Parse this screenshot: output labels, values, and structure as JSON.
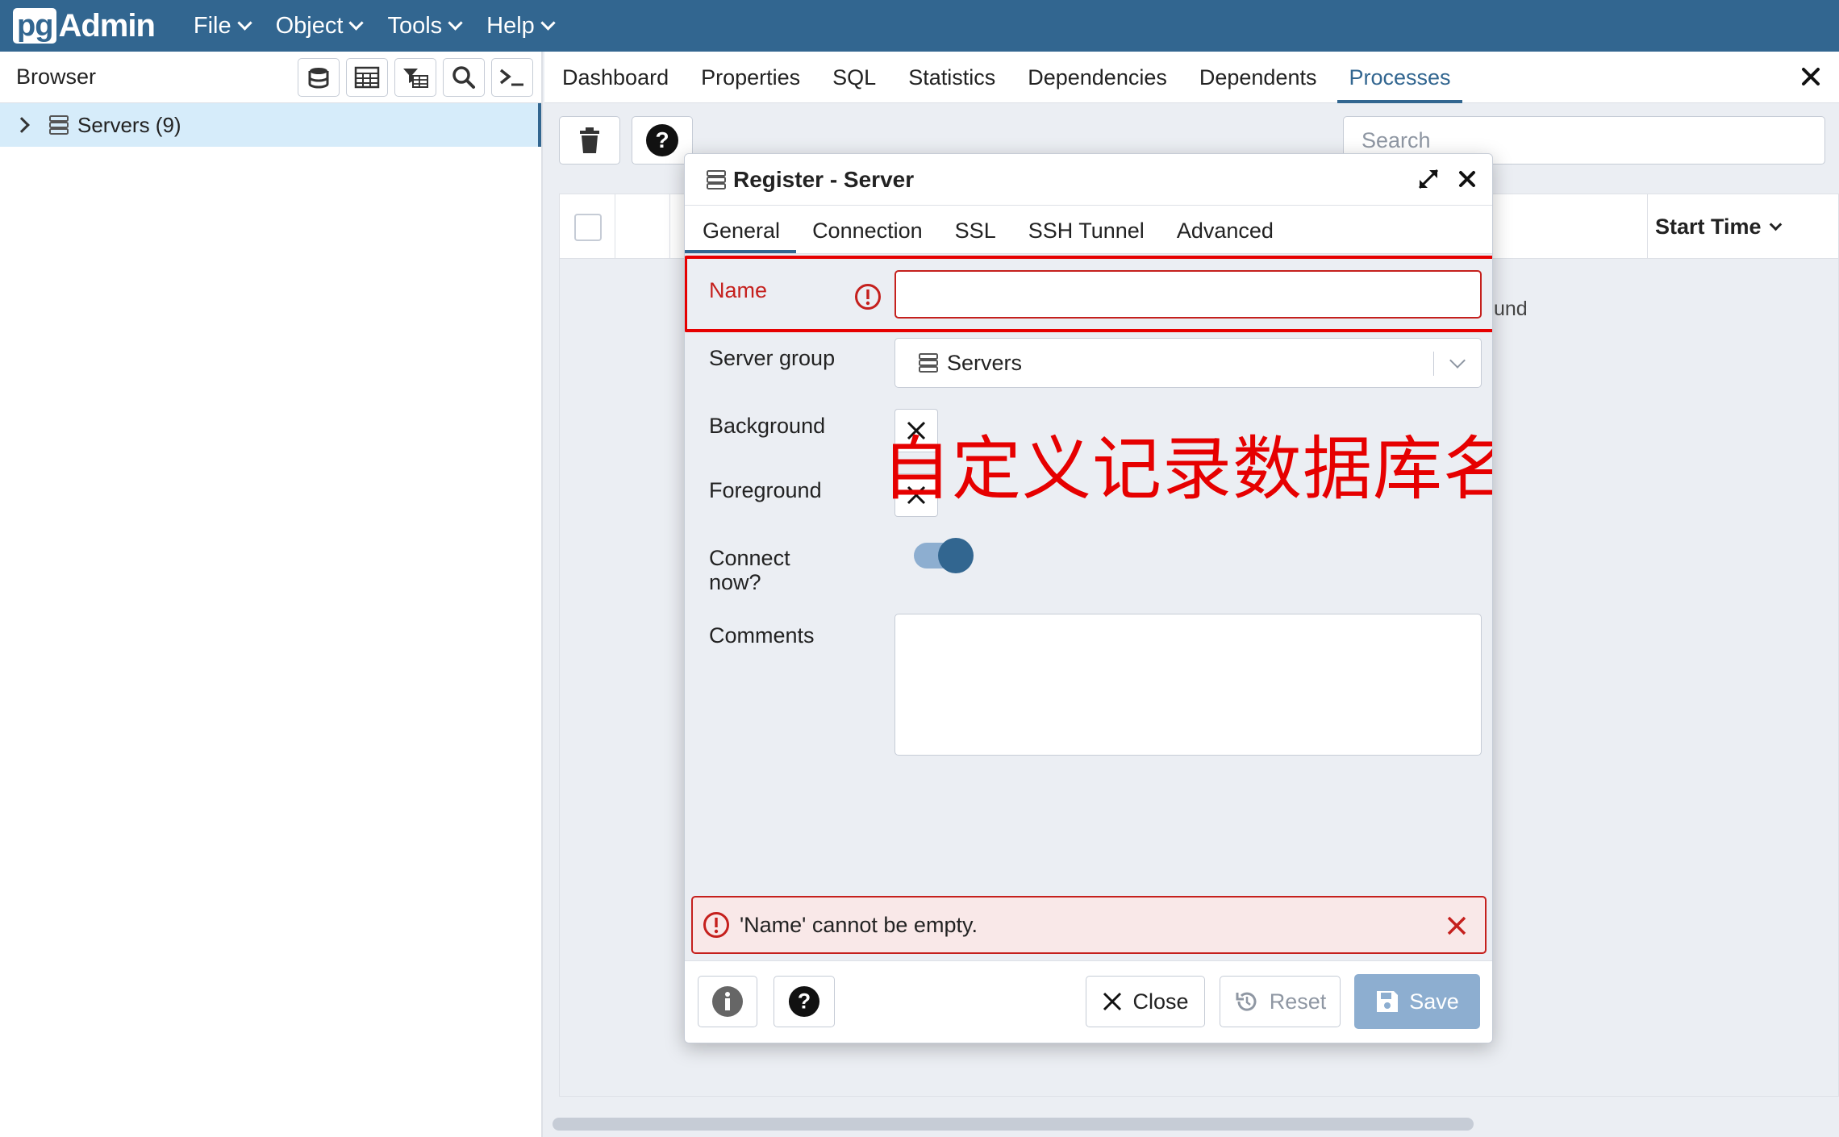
{
  "app": {
    "logo_prefix": "pg",
    "logo_text": "Admin"
  },
  "menu": [
    {
      "label": "File"
    },
    {
      "label": "Object"
    },
    {
      "label": "Tools"
    },
    {
      "label": "Help"
    }
  ],
  "browser": {
    "title": "Browser",
    "tree": [
      {
        "label": "Servers (9)"
      }
    ]
  },
  "main_tabs": [
    "Dashboard",
    "Properties",
    "SQL",
    "Statistics",
    "Dependencies",
    "Dependents",
    "Processes"
  ],
  "active_main_tab": "Processes",
  "search": {
    "placeholder": "Search"
  },
  "grid": {
    "column_start_time": "Start Time",
    "no_rows_fragment": "und"
  },
  "dialog": {
    "title": "Register - Server",
    "tabs": [
      "General",
      "Connection",
      "SSL",
      "SSH Tunnel",
      "Advanced"
    ],
    "active_tab": "General",
    "fields": {
      "name_label": "Name",
      "name_value": "",
      "server_group_label": "Server group",
      "server_group_value": "Servers",
      "background_label": "Background",
      "foreground_label": "Foreground",
      "connect_now_label_1": "Connect",
      "connect_now_label_2": "now?",
      "connect_now_value": true,
      "comments_label": "Comments",
      "comments_value": ""
    },
    "annotation": "自定义记录数据库名称",
    "error_message": "'Name' cannot be empty.",
    "footer": {
      "close_label": "Close",
      "reset_label": "Reset",
      "save_label": "Save"
    }
  },
  "colors": {
    "header_bg": "#326690",
    "accent": "#326690",
    "error": "#c5201d",
    "annotation": "#e60000",
    "save_bg": "#8daed0"
  }
}
